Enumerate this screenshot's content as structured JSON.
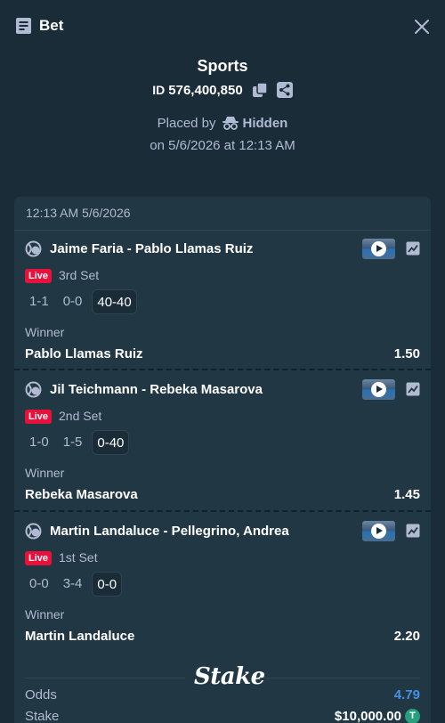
{
  "header": {
    "title": "Bet"
  },
  "summary": {
    "category": "Sports",
    "id_label": "ID",
    "id_value": "576,400,850",
    "placed_by_label": "Placed by",
    "placed_by_user": "Hidden",
    "placed_on": "on 5/6/2026 at 12:13 AM"
  },
  "card": {
    "timestamp": "12:13 AM 5/6/2026",
    "legs": [
      {
        "event": "Jaime Faria - Pablo Llamas Ruiz",
        "status": "Live",
        "set": "3rd Set",
        "scores": [
          "1-1",
          "0-0",
          "40-40"
        ],
        "market": "Winner",
        "selection": "Pablo Llamas Ruiz",
        "odds": "1.50"
      },
      {
        "event": "Jil Teichmann - Rebeka Masarova",
        "status": "Live",
        "set": "2nd Set",
        "scores": [
          "1-0",
          "1-5",
          "0-40"
        ],
        "market": "Winner",
        "selection": "Rebeka Masarova",
        "odds": "1.45"
      },
      {
        "event": "Martin Landaluce - Pellegrino, Andrea",
        "status": "Live",
        "set": "1st Set",
        "scores": [
          "0-0",
          "3-4",
          "0-0"
        ],
        "market": "Winner",
        "selection": "Martin Landaluce",
        "odds": "2.20"
      }
    ],
    "brand": "Stake",
    "odds_label": "Odds",
    "odds_total": "4.79",
    "stake_label": "Stake",
    "stake_value": "$10,000.00",
    "currency_symbol": "T"
  },
  "colors": {
    "background": "#1a2c38",
    "card": "#213743",
    "live": "#e9113c",
    "accent_blue": "#4391e7",
    "tether": "#26a17b"
  }
}
